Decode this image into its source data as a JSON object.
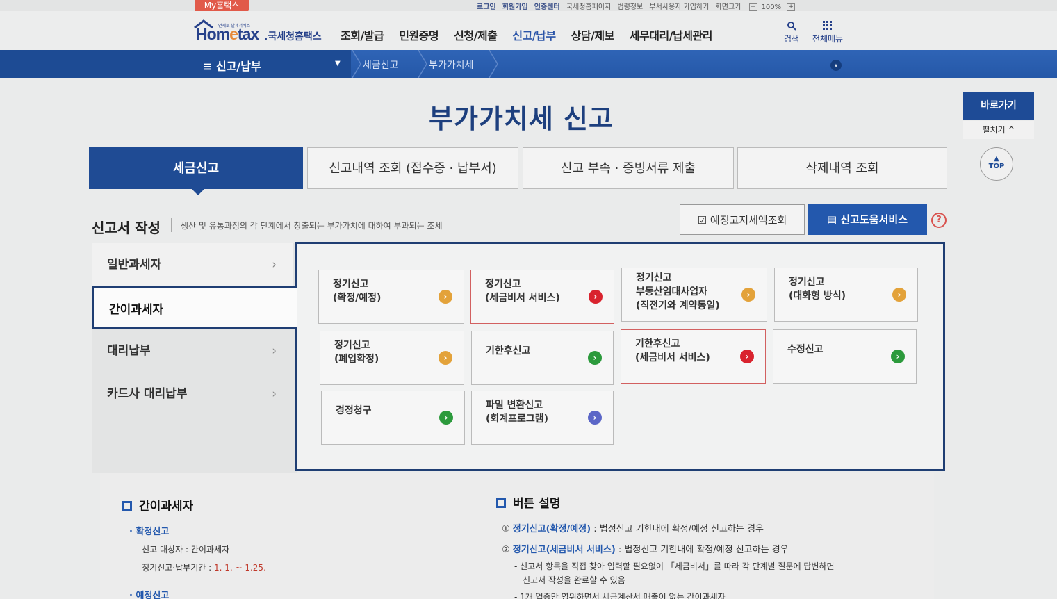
{
  "util": {
    "my_tab": "My홈택스",
    "links": [
      "로그인",
      "회원가입",
      "인증센터",
      "국세청홈페이지",
      "법령정보",
      "부서사용자 가입하기",
      "화면크기"
    ],
    "zoom_minus": "−",
    "zoom_value": "100%",
    "zoom_plus": "+"
  },
  "header": {
    "logo_small": "언제보 날세서비스",
    "logo_word_a": "Hom",
    "logo_word_b": "e",
    "logo_word_c": "tax",
    "logo_kr": ".국세청홈택스",
    "gnb": [
      "조회/발급",
      "민원증명",
      "신청/제출",
      "신고/납부",
      "상담/제보",
      "세무대리/납세관리"
    ],
    "gnb_active_index": 3,
    "search_label": "검색",
    "menu_label": "전체메뉴"
  },
  "nav": {
    "menu_icon": "≡",
    "title": "신고/납부",
    "crumbs": [
      "세금신고",
      "부가가치세"
    ]
  },
  "page": {
    "title": "부가가치세 신고"
  },
  "quick": {
    "label": "바로가기",
    "fold": "펼치기 ^",
    "top": "TOP"
  },
  "tabs": [
    "세금신고",
    "신고내역 조회 (접수증 · 납부서)",
    "신고 부속 · 증빙서류 제출",
    "삭제내역 조회"
  ],
  "section": {
    "title": "신고서 작성",
    "desc": "생산 및 유통과정의 각 단계에서 창출되는 부가가치에 대하여 부과되는 조세",
    "btn_preview": "예정고지세액조회",
    "btn_help": "신고도움서비스",
    "help_icon": "?"
  },
  "left_menu": [
    "일반과세자",
    "간이과세자",
    "대리납부",
    "카드사 대리납부"
  ],
  "left_menu_active": 1,
  "cards": [
    {
      "line1": "정기신고",
      "line2": "(확정/예정)",
      "line3": "",
      "color": "orange"
    },
    {
      "line1": "정기신고",
      "line2": "(세금비서 서비스)",
      "line3": "",
      "color": "red"
    },
    {
      "line1": "정기신고",
      "line2": "부동산임대사업자",
      "line3": "(직전기와 계약동일)",
      "color": "orange"
    },
    {
      "line1": "정기신고",
      "line2": "(대화형 방식)",
      "line3": "",
      "color": "orange"
    },
    {
      "line1": "정기신고",
      "line2": "(폐업확정)",
      "line3": "",
      "color": "orange"
    },
    {
      "line1": "기한후신고",
      "line2": "",
      "line3": "",
      "color": "green"
    },
    {
      "line1": "기한후신고",
      "line2": "(세금비서 서비스)",
      "line3": "",
      "color": "red"
    },
    {
      "line1": "수정신고",
      "line2": "",
      "line3": "",
      "color": "green"
    },
    {
      "line1": "경정청구",
      "line2": "",
      "line3": "",
      "color": "green"
    },
    {
      "line1": "파일 변환신고",
      "line2": "(회계프로그램)",
      "line3": "",
      "color": "blue"
    }
  ],
  "card_arrow": "›",
  "lower_left": {
    "title": "간이과세자",
    "b1": "· 확정신고",
    "l1": "- 신고 대상자 : 간이과세자",
    "l2a": "- 정기신고·납부기간 : ",
    "l2b": "1. 1. ~ 1.25.",
    "b2": "· 예정신고"
  },
  "lower_right": {
    "title": "버튼 설명",
    "r1a": "① ",
    "r1b": "정기신고(확정/예정)",
    "r1c": " : 법정신고 기한내에 확정/예정 신고하는 경우",
    "r2a": "② ",
    "r2b": "정기신고(세금비서 서비스)",
    "r2c": " : 법정신고 기한내에 확정/예정 신고하는 경우",
    "r3": "- 신고서 항목을 직접 찾아 입력할 필요없이 「세금비서」를 따라 각 단계별 질문에 답변하면",
    "r4": "신고서 작성을 완료할 수 있음",
    "r5": "- 1개 업종만 영위하면서 세금계산서 매출이 없는 간이과세자"
  },
  "colors": {
    "primary": "#1f4b94",
    "nav": "#2a5cad",
    "orange": "#e3a23a",
    "red": "#d9232e",
    "green": "#2c9a3c",
    "blue": "#5b66c7"
  }
}
